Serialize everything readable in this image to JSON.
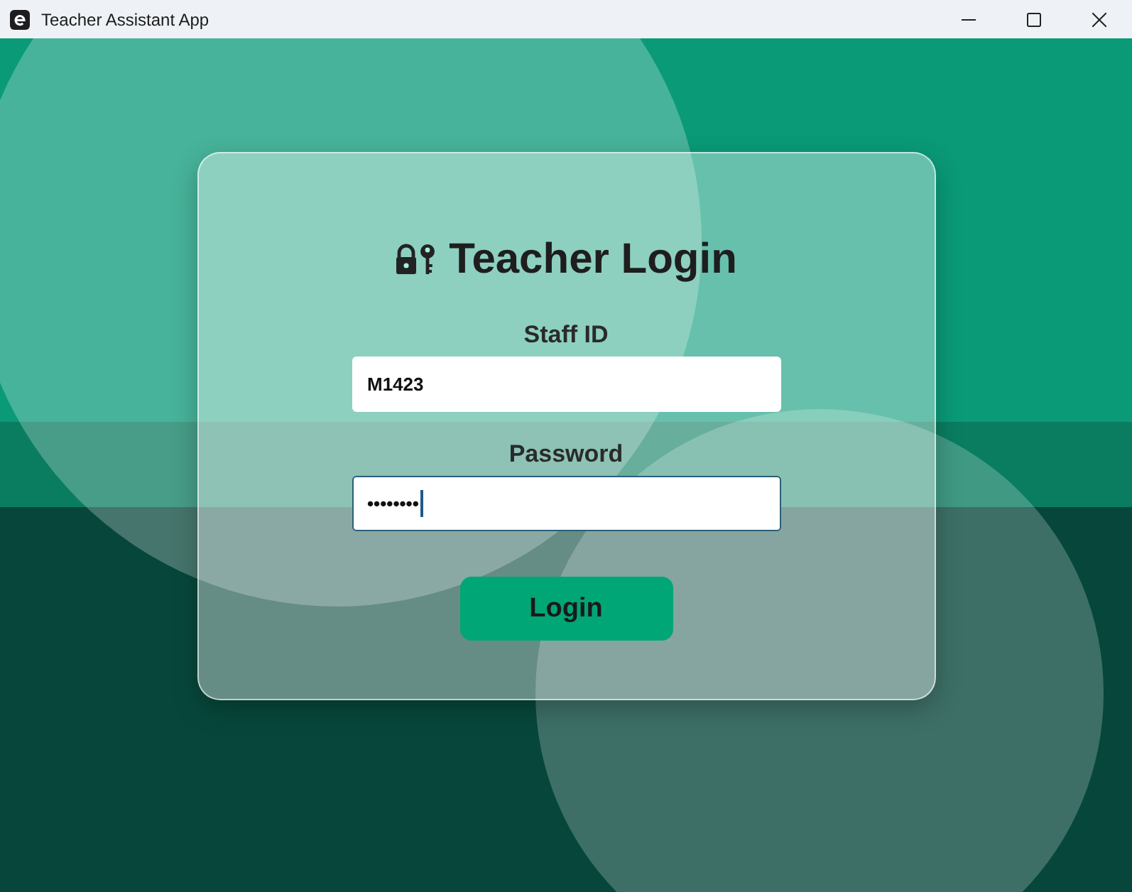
{
  "window": {
    "title": "Teacher Assistant App"
  },
  "login": {
    "title": "Teacher Login",
    "fields": [
      {
        "label": "Staff ID",
        "value": "M1423",
        "focused": false
      },
      {
        "label": "Password",
        "value": "••••••••",
        "focused": true
      }
    ],
    "button": "Login"
  }
}
